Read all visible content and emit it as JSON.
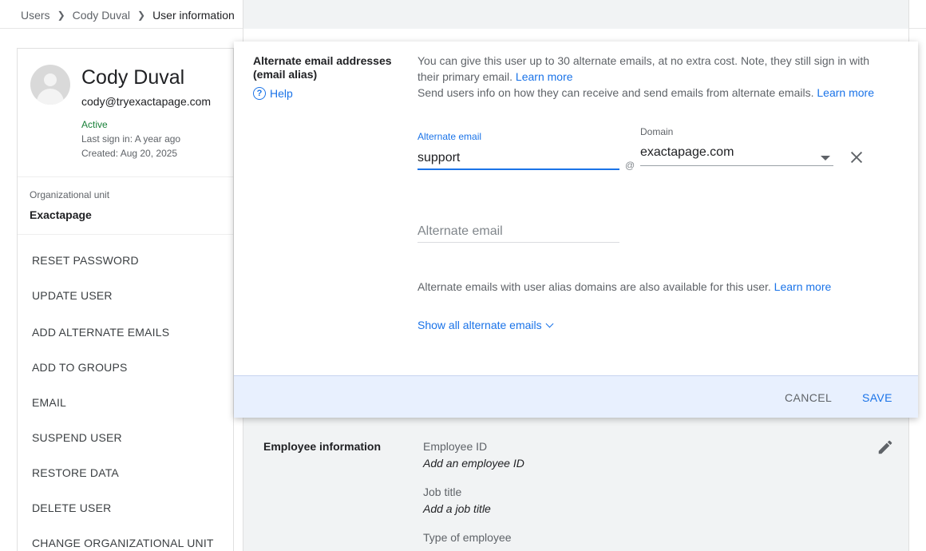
{
  "breadcrumb": {
    "items": [
      "Users",
      "Cody Duval",
      "User information"
    ]
  },
  "user": {
    "name": "Cody Duval",
    "email": "cody@tryexactapage.com",
    "status": "Active",
    "last_sign_in": "Last sign in: A year ago",
    "created": "Created: Aug 20, 2025"
  },
  "org_unit": {
    "label": "Organizational unit",
    "value": "Exactapage"
  },
  "actions": [
    "RESET PASSWORD",
    "UPDATE USER",
    "ADD ALTERNATE EMAILS",
    "ADD TO GROUPS",
    "EMAIL",
    "SUSPEND USER",
    "RESTORE DATA",
    "DELETE USER",
    "CHANGE ORGANIZATIONAL UNIT"
  ],
  "dialog": {
    "title": "Alternate email addresses (email alias)",
    "help_label": "Help",
    "desc1": "You can give this user up to 30 alternate emails, at no extra cost. Note, they still sign in with their primary email.",
    "desc1_link": "Learn more",
    "desc2": "Send users info on how they can receive and send emails from alternate emails.",
    "desc2_link": "Learn more",
    "alt_email_label": "Alternate email",
    "alt_email_value": "support",
    "at": "@",
    "domain_label": "Domain",
    "domain_value": "exactapage.com",
    "alt_email_placeholder": "Alternate email",
    "alias_note": "Alternate emails with user alias domains are also available for this user.",
    "alias_note_link": "Learn more",
    "show_all": "Show all alternate emails",
    "cancel": "CANCEL",
    "save": "SAVE"
  },
  "employee": {
    "title": "Employee information",
    "id_label": "Employee ID",
    "id_value": "Add an employee ID",
    "job_label": "Job title",
    "job_value": "Add a job title",
    "type_label": "Type of employee"
  },
  "colors": {
    "accent": "#1a73e8",
    "active_status": "#188038",
    "footer_bg": "#e8f0fe"
  },
  "icons": [
    "chevron-right-icon",
    "avatar-icon",
    "help-icon",
    "close-icon",
    "dropdown-caret-icon",
    "chevron-down-icon",
    "edit-pencil-icon"
  ]
}
